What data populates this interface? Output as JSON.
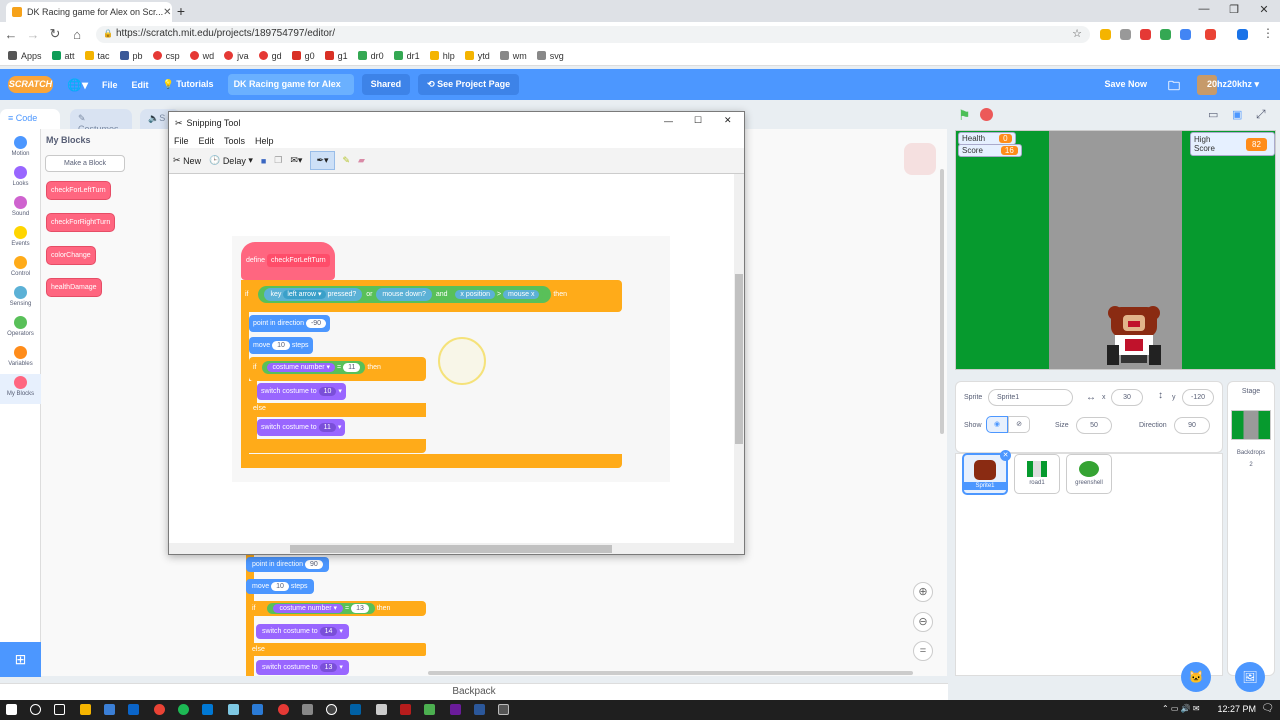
{
  "browser": {
    "tab_title": "DK Racing game for Alex on Scr...",
    "url": "https://scratch.mit.edu/projects/189754797/editor/",
    "bookmarks": [
      "Apps",
      "att",
      "tac",
      "pb",
      "csp",
      "wd",
      "jva",
      "gd",
      "g0",
      "g1",
      "dr0",
      "dr1",
      "hlp",
      "ytd",
      "wm",
      "svg"
    ]
  },
  "menubar": {
    "logo": "SCRATCH",
    "file": "File",
    "edit": "Edit",
    "tutorials": "Tutorials",
    "project_title": "DK Racing game for Alex",
    "shared": "Shared",
    "see_project_page": "See Project Page",
    "save_now": "Save Now",
    "username": "20hz20khz"
  },
  "editor_tabs": {
    "code": "Code",
    "costumes": "Costumes",
    "sounds": "S"
  },
  "categories": [
    {
      "label": "Motion",
      "color": "#4c97ff"
    },
    {
      "label": "Looks",
      "color": "#9966ff"
    },
    {
      "label": "Sound",
      "color": "#cf63cf"
    },
    {
      "label": "Events",
      "color": "#ffd500"
    },
    {
      "label": "Control",
      "color": "#ffab19"
    },
    {
      "label": "Sensing",
      "color": "#5cb1d6"
    },
    {
      "label": "Operators",
      "color": "#59c059"
    },
    {
      "label": "Variables",
      "color": "#ff8c1a"
    },
    {
      "label": "My Blocks",
      "color": "#ff6680"
    }
  ],
  "palette": {
    "title": "My Blocks",
    "make_block": "Make a Block",
    "blocks": [
      "checkForLeftTurn",
      "checkForRightTurn",
      "colorChange",
      "healthDamage"
    ]
  },
  "workspace_script": {
    "point_in_direction": "point in direction",
    "direction_value": "90",
    "move": "move",
    "move_value": "10",
    "steps": "steps",
    "if": "if",
    "costume": "costume",
    "number": "number",
    "equals": "=",
    "compare_value": "13",
    "then": "then",
    "switch_costume": "switch costume to",
    "costume_a": "14",
    "else": "else",
    "costume_b": "13"
  },
  "snip": {
    "title": "Snipping Tool",
    "menu": [
      "File",
      "Edit",
      "Tools",
      "Help"
    ],
    "new": "New",
    "delay": "Delay",
    "define": "define",
    "define_name": "checkForLeftTurn",
    "if": "if",
    "key": "key",
    "key_option": "left arrow",
    "pressed": "pressed?",
    "or": "or",
    "mouse_down": "mouse down?",
    "and": "and",
    "x_position": "x position",
    "gt": ">",
    "mouse_x": "mouse x",
    "then": "then",
    "point_in_direction": "point in direction",
    "direction_value": "-90",
    "move": "move",
    "move_value": "10",
    "steps": "steps",
    "costume": "costume",
    "number": "number",
    "equals": "=",
    "compare_value": "11",
    "switch_costume": "switch costume to",
    "costume_a": "10",
    "else": "else",
    "costume_b": "11"
  },
  "backpack": "Backpack",
  "stage": {
    "health_label": "Health",
    "health_value": "0",
    "score_label": "Score",
    "score_value": "16",
    "high_score_label": "High Score",
    "high_score_value": "82"
  },
  "sprite_info": {
    "sprite_label": "Sprite",
    "sprite_name": "Sprite1",
    "x_label": "x",
    "x_value": "30",
    "y_label": "y",
    "y_value": "-120",
    "show_label": "Show",
    "size_label": "Size",
    "size_value": "50",
    "direction_label": "Direction",
    "direction_value": "90"
  },
  "sprites": [
    "Sprite1",
    "road1",
    "greenshell"
  ],
  "stage_panel": {
    "title": "Stage",
    "backdrops_label": "Backdrops",
    "backdrops_count": "2"
  },
  "taskbar": {
    "time": "12:27 PM"
  }
}
